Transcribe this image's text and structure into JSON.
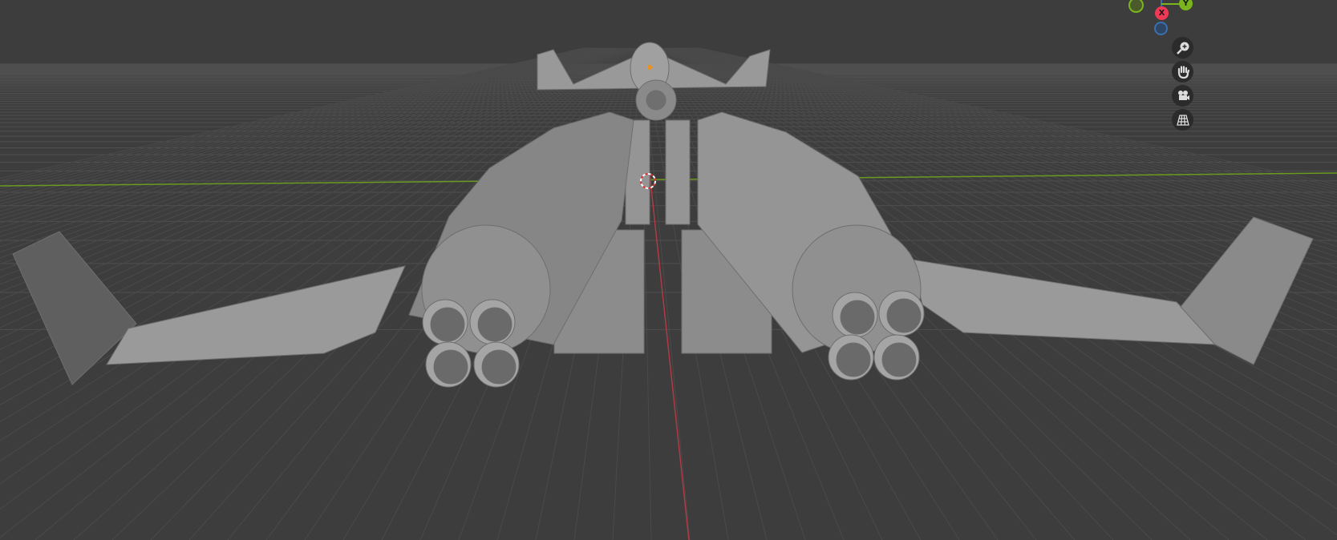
{
  "viewport": {
    "background": "#3d3d3d",
    "x_axis_color": "#b03a45",
    "y_axis_color": "#6a9a1f",
    "model_color": "#8f8f8f"
  },
  "gizmo": {
    "x_label": "X",
    "y_label": "Y",
    "x_color": "#f03a55",
    "y_color": "#7ab51d",
    "z_color": "#3b6fb0"
  },
  "nav_buttons": [
    {
      "icon": "zoom-icon"
    },
    {
      "icon": "hand-pan-icon"
    },
    {
      "icon": "camera-icon"
    },
    {
      "icon": "grid-ortho-icon"
    }
  ]
}
